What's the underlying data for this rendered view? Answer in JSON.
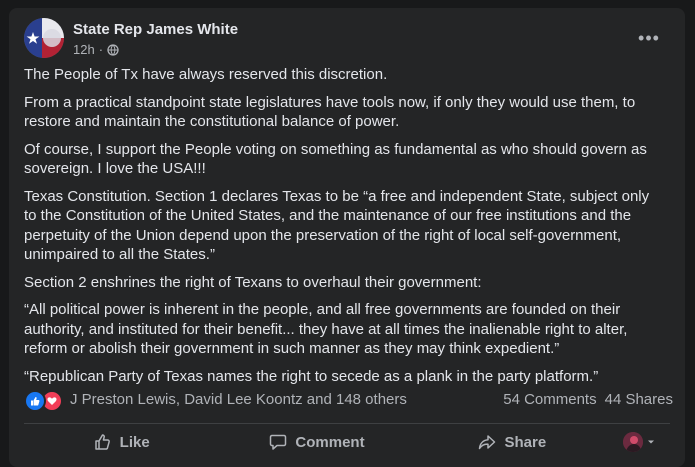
{
  "post": {
    "author": "State Rep James White",
    "time": "12h",
    "visibility_icon": "globe-icon",
    "paragraphs": [
      "The People of Tx have always reserved this discretion.",
      "From a practical standpoint state legislatures have tools now, if only they would use them, to restore and maintain the constitutional balance of power.",
      "Of course, I support the People voting on something as fundamental as who should govern as sovereign. I love the USA!!!",
      "Texas Constitution. Section 1 declares Texas to be “a free and independent State, subject only to the Constitution of the United States, and the maintenance of our free institutions and the perpetuity of the Union depend upon the preservation of the right of local self-government, unimpaired to all the States.”",
      "Section 2 enshrines the right of Texans to overhaul their government:",
      "“All political power is inherent in the people, and all free governments are founded on their authority, and instituted for their benefit... they have at all times the inalienable right to alter, reform or abolish their government in such manner as they may think expedient.”",
      "“Republican Party of Texas names the right to secede as a plank in the party platform.”"
    ]
  },
  "stats": {
    "reaction_icons": [
      "like-reaction-icon",
      "love-reaction-icon"
    ],
    "reactors": "J Preston Lewis, David Lee Koontz and 148 others",
    "comments": "54 Comments",
    "shares": "44 Shares"
  },
  "actions": {
    "like": "Like",
    "comment": "Comment",
    "share": "Share"
  },
  "colors": {
    "background": "#18191a",
    "card": "#242526",
    "text": "#e4e6eb",
    "secondary": "#b0b3b8",
    "like_blue": "#1877f2",
    "love_red": "#f33e58"
  }
}
